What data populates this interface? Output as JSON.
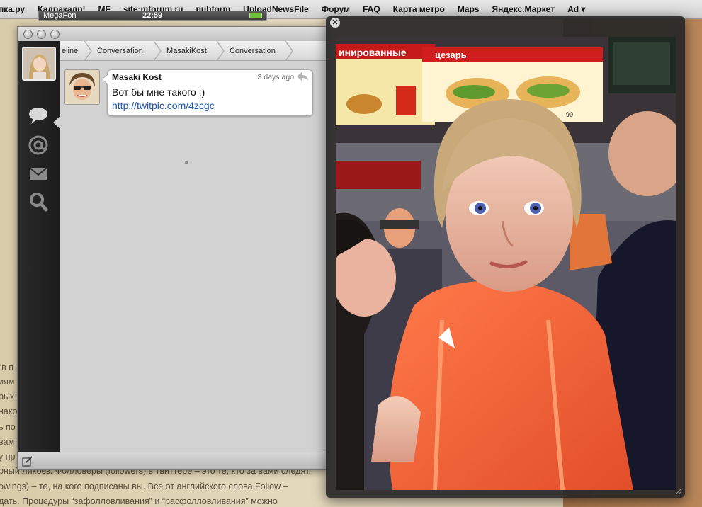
{
  "bookmarks": [
    "пка.ру",
    "Кадракадр!",
    "MF",
    "site:mforum.ru",
    "pubform",
    "UploadNewsFile",
    "Форум",
    "FAQ",
    "Карта метро",
    "Maps",
    "Яндекс.Маркет",
    "Ad ▾"
  ],
  "article_lines": [
    "“в п",
    "иям",
    "рых",
    "нако",
    "ь по",
    "вам",
    "у пр",
    "рный ликбез. Фолловеры (followers) в твиттере – это те, кто за вами следят.",
    "owings) – те, на кого подписаны вы. Все от английского слова Follow –",
    "дать. Процедуры “зафолловливания” и “расфолловливания” можно"
  ],
  "status_bar": {
    "carrier": "MegaFon",
    "time": "22:59"
  },
  "breadcrumb": [
    "eline",
    "Conversation",
    "MasakiKost",
    "Conversation"
  ],
  "tweet": {
    "author": "Masaki Kost",
    "time": "3 days ago",
    "text": "Вот бы мне такого ;)",
    "link": "http://twitpic.com/4zcgc"
  },
  "icons": {
    "conversation": "speech-bubble-icon",
    "mentions": "at-icon",
    "messages": "envelope-icon",
    "search": "magnifier-icon",
    "compose": "compose-icon",
    "reply": "reply-icon",
    "close": "close-icon"
  },
  "photo_text": [
    "цезарь",
    "инированные",
    "90",
    "90"
  ]
}
